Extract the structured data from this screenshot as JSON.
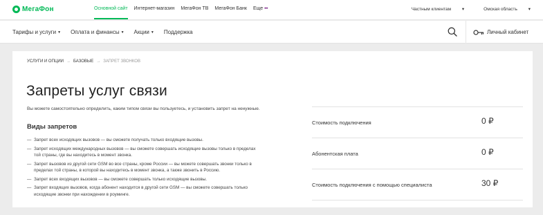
{
  "brand": {
    "name": "МегаФон",
    "accent": "#00b956",
    "purple": "#731982"
  },
  "top_nav": {
    "items": [
      "Основной сайт",
      "Интернет-магазин",
      "МегаФон ТВ",
      "МегаФон Банк",
      "Еще"
    ],
    "active_index": 0,
    "more_dots": "•••",
    "client_type": "Частным клиентам",
    "region": "Омская область",
    "dropdown_glyph": "▾"
  },
  "main_nav": {
    "items": [
      {
        "label": "Тарифы и услуги",
        "has_caret": true
      },
      {
        "label": "Оплата и финансы",
        "has_caret": true
      },
      {
        "label": "Акции",
        "has_caret": true
      },
      {
        "label": "Поддержка",
        "has_caret": false
      }
    ],
    "cabinet_label": "Личный кабинет"
  },
  "breadcrumb": {
    "items": [
      "УСЛУГИ И ОПЦИИ",
      "БАЗОВЫЕ",
      "ЗАПРЕТ ЗВОНКОВ"
    ],
    "separator": "→"
  },
  "page": {
    "title": "Запреты услуг связи",
    "intro": "Вы можете самостоятельно определить, каким типом связи вы пользуетесь, и установить запрет на ненужные.",
    "section_title": "Виды запретов",
    "bans": [
      "Запрет всех исходящих вызовов — вы сможете получать только входящие вызовы.",
      "Запрет исходящих международных вызовов — вы сможете совершать исходящие вызовы только в пределах той страны, где вы находитесь   в момент звонка.",
      "Запрет вызовов из другой сети GSM во все страны, кроме России — вы можете совершать звонки только в пределах той страны,   в которой вы находитесь в момент звонка, а также звонить в Россию.",
      "Запрет всех входящих вызовов — вы сможете совершать только исходящие вызовы.",
      "Запрет входящих вызовов, когда абонент находится в другой сети GSM — вы сможете совершать только исходящие звонки при  нахождении в роуминге."
    ]
  },
  "prices": [
    {
      "label": "Стоимость подключения",
      "value": "0 ₽"
    },
    {
      "label": "Абонентская плата",
      "value": "0 ₽"
    },
    {
      "label": "Стоимость подключения с помощью специалиста",
      "value": "30 ₽"
    }
  ]
}
